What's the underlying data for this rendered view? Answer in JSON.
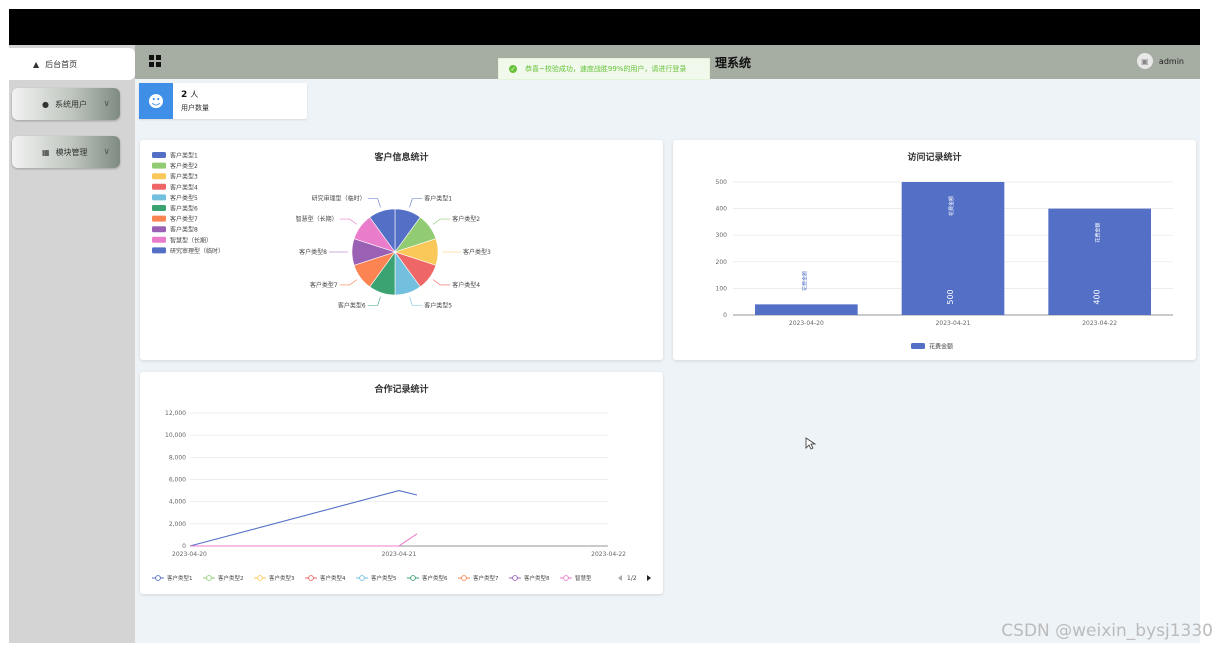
{
  "sidebar": {
    "home_label": "后台首页",
    "items": [
      {
        "label": "系统用户"
      },
      {
        "label": "模块管理"
      }
    ]
  },
  "header": {
    "title": "理系统",
    "user": "admin"
  },
  "toast": {
    "message": "恭喜~校验成功，速度战胜99%的用户，请进行登录"
  },
  "stat": {
    "count": "2",
    "unit": "人",
    "label": "用户数量"
  },
  "pie_card": {
    "title": "客户信息统计",
    "legend": [
      "客户类型1",
      "客户类型2",
      "客户类型3",
      "客户类型4",
      "客户类型5",
      "客户类型6",
      "客户类型7",
      "客户类型8",
      "智慧型（长期）",
      "研究审理型（临时）"
    ],
    "slice_labels": [
      "客户类型1",
      "客户类型2",
      "客户类型3",
      "客户类型4",
      "客户类型5",
      "客户类型6",
      "客户类型7",
      "客户类型8",
      "智慧型（长期）",
      "研究审理型（临时）"
    ],
    "colors": [
      "#5470c6",
      "#91cc75",
      "#fac858",
      "#ee6666",
      "#73c0de",
      "#3ba272",
      "#fc8452",
      "#9a60b4",
      "#ea7ccc",
      "#5470c6"
    ]
  },
  "bar_card": {
    "title": "访问记录统计",
    "legend": "花费金额",
    "bar_label": "花费金额",
    "color": "#5470c6"
  },
  "line_card": {
    "title": "合作记录统计",
    "legend": [
      "客户类型1",
      "客户类型2",
      "客户类型3",
      "客户类型4",
      "客户类型5",
      "客户类型6",
      "客户类型7",
      "客户类型8",
      "智慧型"
    ],
    "legend_colors": [
      "#5470c6",
      "#91cc75",
      "#fac858",
      "#ee6666",
      "#73c0de",
      "#3ba272",
      "#fc8452",
      "#9a60b4",
      "#ea7ccc"
    ],
    "pager": "1/2"
  },
  "chart_data": [
    {
      "type": "pie",
      "title": "客户信息统计",
      "categories": [
        "客户类型1",
        "客户类型2",
        "客户类型3",
        "客户类型4",
        "客户类型5",
        "客户类型6",
        "客户类型7",
        "客户类型8",
        "智慧型（长期）",
        "研究审理型（临时）"
      ],
      "values": [
        1,
        1,
        1,
        1,
        1,
        1,
        1,
        1,
        1,
        1
      ],
      "legend": "left"
    },
    {
      "type": "bar",
      "title": "访问记录统计",
      "categories": [
        "2023-04-20",
        "2023-04-21",
        "2023-04-22"
      ],
      "series": [
        {
          "name": "花费金额",
          "values": [
            40,
            500,
            400
          ]
        }
      ],
      "data_labels": [
        "",
        "500",
        "400"
      ],
      "yticks": [
        "0",
        "100",
        "200",
        "300",
        "400",
        "500"
      ],
      "ylim": [
        0,
        500
      ],
      "legend": "bottom"
    },
    {
      "type": "line",
      "title": "合作记录统计",
      "x": [
        "2023-04-20",
        "2023-04-21",
        "2023-04-22"
      ],
      "series": [
        {
          "name": "客户类型1",
          "points": [
            [
              "2023-04-20",
              0
            ],
            [
              "2023-04-21",
              5000
            ],
            [
              "2023-04-21",
              4600
            ]
          ]
        },
        {
          "name": "智慧型",
          "points": [
            [
              "2023-04-20",
              0
            ],
            [
              "2023-04-21",
              0
            ],
            [
              "2023-04-21",
              1100
            ]
          ]
        }
      ],
      "yticks": [
        "0",
        "2,000",
        "4,000",
        "6,000",
        "8,000",
        "10,000",
        "12,000"
      ],
      "ylim": [
        0,
        12000
      ],
      "legend": "bottom"
    }
  ],
  "watermark": "CSDN @weixin_bysj1330"
}
